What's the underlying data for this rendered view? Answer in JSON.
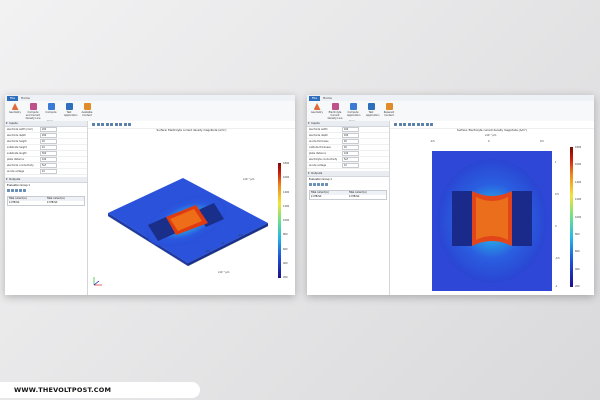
{
  "footer": {
    "site": "WWW.THEVOLTPOST.COM"
  },
  "left_window": {
    "tabs": [
      "File",
      "Home"
    ],
    "ribbon": [
      {
        "label": "Geometry",
        "icon": "geometry-icon",
        "color": "#e06a3a"
      },
      {
        "label": "Compute and Current Density Line",
        "icon": "compute-icon",
        "color": "#c0508a"
      },
      {
        "label": "Compute",
        "icon": "equals-icon",
        "color": "#3a7bd5"
      },
      {
        "label": "Test Application",
        "icon": "test-app-icon",
        "color": "#2e6fbd"
      },
      {
        "label": "Available Content",
        "icon": "content-icon",
        "color": "#e08a2a"
      }
    ],
    "ribbon_group": "Home",
    "inputs_header": "Inputs",
    "params": [
      {
        "name": "electrode width (mm)",
        "value": "200"
      },
      {
        "name": "electrode depth",
        "value": "200"
      },
      {
        "name": "electrode height",
        "value": "20"
      },
      {
        "name": "substrate height",
        "value": "10"
      },
      {
        "name": "substrate length",
        "value": "500"
      },
      {
        "name": "plate distance",
        "value": "100"
      },
      {
        "name": "electrode conductivity",
        "value": "5e7"
      },
      {
        "name": "anode voltage",
        "value": "10"
      }
    ],
    "outputs_header": "Outputs",
    "table_label": "Evaluation Group 1",
    "table_headers": [
      "Total current (A)",
      "Total current (A)"
    ],
    "table_row": [
      "2.9787e4",
      "2.9787e4"
    ],
    "plot_title": "Surface: Electrolyte current density magnitude (A/m²)",
    "x_ticks": [
      "-0.5",
      "0",
      "0.5"
    ],
    "y_ticks": [
      "0.5",
      "0",
      "-0.5"
    ],
    "axis_unit": "x10⁻³ μm",
    "cbar_ticks": [
      "1800",
      "1600",
      "1400",
      "1200",
      "1000",
      "800",
      "600",
      "400",
      "200"
    ]
  },
  "right_window": {
    "tabs": [
      "File",
      "Home"
    ],
    "ribbon": [
      {
        "label": "Geometry",
        "icon": "geometry-icon",
        "color": "#e06a3a"
      },
      {
        "label": "Electrolyte Current Density Line",
        "icon": "compute-icon",
        "color": "#c0508a"
      },
      {
        "label": "Compute Application",
        "icon": "equals-icon",
        "color": "#3a7bd5"
      },
      {
        "label": "Test Application",
        "icon": "test-app-icon",
        "color": "#2e6fbd"
      },
      {
        "label": "Relevant Content",
        "icon": "content-icon",
        "color": "#e08a2a"
      }
    ],
    "ribbon_group": "Home",
    "inputs_header": "Inputs",
    "params": [
      {
        "name": "electrode width",
        "value": "200"
      },
      {
        "name": "electrode depth",
        "value": "200"
      },
      {
        "name": "anode thickness",
        "value": "20"
      },
      {
        "name": "cathode thickness",
        "value": "20"
      },
      {
        "name": "plate distance",
        "value": "100"
      },
      {
        "name": "electrolyte conductivity",
        "value": "5e7"
      },
      {
        "name": "anode voltage",
        "value": "10"
      }
    ],
    "outputs_header": "Outputs",
    "table_label": "Evaluation Group 1",
    "table_headers": [
      "Total current (A)",
      "Total current (A)"
    ],
    "table_row": [
      "2.9787e4",
      "2.9787e4"
    ],
    "plot_title": "Surface: Electrolyte current density magnitude (A/m²)",
    "top_ticks": [
      "-0.5",
      "0",
      "0.5"
    ],
    "right_ticks": [
      "1",
      "0.5",
      "0",
      "-0.5",
      "-1"
    ],
    "axis_unit": "x10⁻³ μm",
    "cbar_ticks": [
      "1800",
      "1600",
      "1400",
      "1200",
      "1000",
      "800",
      "600",
      "400",
      "200"
    ]
  }
}
